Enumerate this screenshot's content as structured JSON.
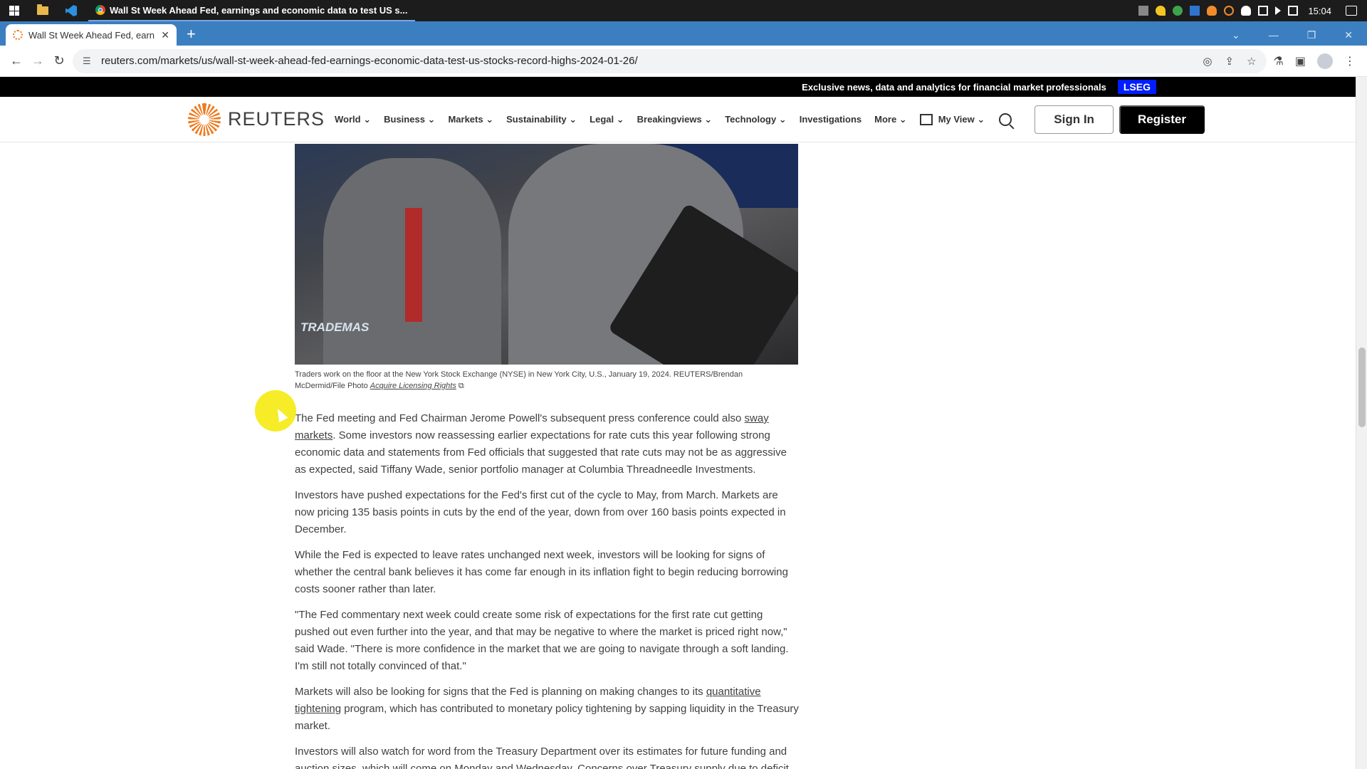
{
  "taskbar": {
    "window_title": "Wall St Week Ahead Fed, earnings and economic data to test US s...",
    "time": "15:04"
  },
  "browser": {
    "tab_title": "Wall St Week Ahead Fed, earn",
    "new_tab_label": "+",
    "url": "reuters.com/markets/us/wall-st-week-ahead-fed-earnings-economic-data-test-us-stocks-record-highs-2024-01-26/"
  },
  "site": {
    "promo_text": "Exclusive news, data and analytics for financial market professionals",
    "promo_badge": "LSEG",
    "logo_text": "REUTERS",
    "nav": [
      "World",
      "Business",
      "Markets",
      "Sustainability",
      "Legal",
      "Breakingviews",
      "Technology",
      "Investigations",
      "More"
    ],
    "myview_label": "My View",
    "signin_label": "Sign In",
    "register_label": "Register"
  },
  "article": {
    "photo_text": "TRADEMAS",
    "caption": "Traders work on the floor at the New York Stock Exchange (NYSE) in New York City, U.S., January 19, 2024. REUTERS/Brendan McDermid/File Photo",
    "caption_link": "Acquire Licensing Rights",
    "p1_a": "The Fed meeting and Fed Chairman Jerome Powell's subsequent press conference could also ",
    "p1_link": "sway markets",
    "p1_b": ". Some investors now reassessing earlier expectations for rate cuts this year following strong economic data and statements from Fed officials that suggested that rate cuts may not be as aggressive as expected, said Tiffany Wade, senior portfolio manager at Columbia Threadneedle Investments.",
    "p2": "Investors have pushed expectations for the Fed's first cut of the cycle to May, from March. Markets are now pricing 135 basis points in cuts by the end of the year, down from over 160 basis points expected in December.",
    "p3": "While the Fed is expected to leave rates unchanged next week, investors will be looking for signs of whether the central bank believes it has come far enough in its inflation fight to begin reducing borrowing costs sooner rather than later.",
    "p4": "\"The Fed commentary next week could create some risk of expectations for the first rate cut getting pushed out even further into the year, and that may be negative to where the market is priced right now,\" said Wade. \"There is more confidence in the market that we are going to navigate through a soft landing. I'm still not totally convinced of that.\"",
    "p5_a": "Markets will also be looking for signs that the Fed is planning on making changes to its ",
    "p5_link": "quantitative tightening",
    "p5_b": " program, which has contributed to monetary policy tightening by sapping liquidity in the Treasury market.",
    "p6": "Investors will also watch for word from the Treasury Department over its estimates for future funding and auction sizes, which will come on Monday and Wednesday. Concerns over Treasury supply due to deficit"
  },
  "colors": {
    "accent": "#f07a1d",
    "lseg_blue": "#001eff",
    "tabstrip": "#3c7fc1"
  }
}
